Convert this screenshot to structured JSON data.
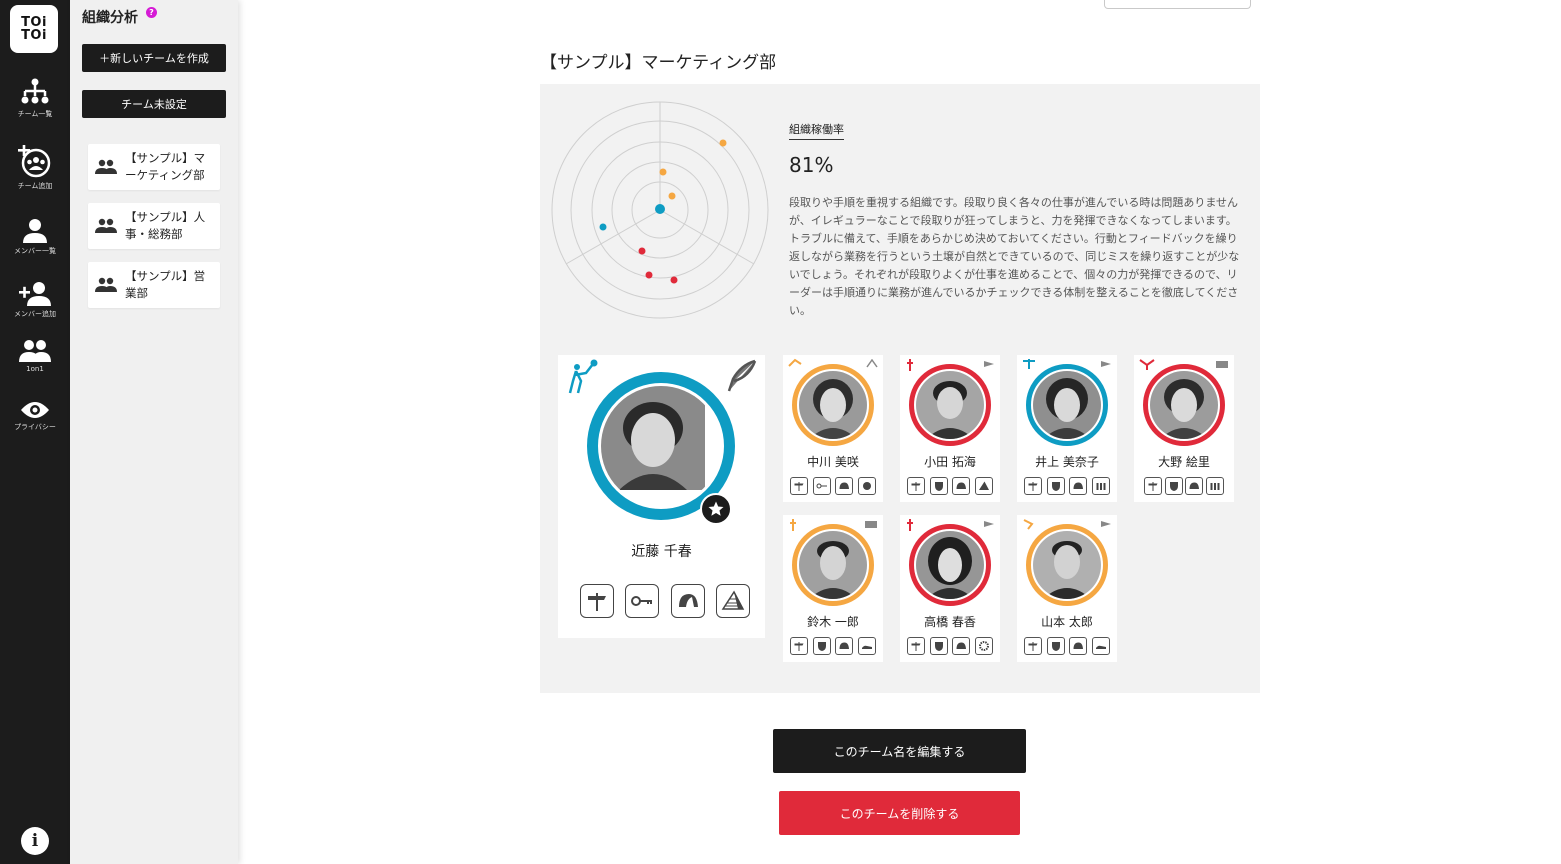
{
  "app": {
    "logo_text_1": "TOi",
    "logo_text_2": "TOi"
  },
  "rail": {
    "items": [
      {
        "label": "チーム一覧",
        "icon": "org-chart-icon"
      },
      {
        "label": "チーム追加",
        "icon": "add-team-icon"
      },
      {
        "label": "メンバー一覧",
        "icon": "person-icon"
      },
      {
        "label": "メンバー追加",
        "icon": "add-person-icon"
      },
      {
        "label": "1on1",
        "icon": "people-icon"
      },
      {
        "label": "プライバシー",
        "icon": "eye-icon"
      }
    ],
    "info_glyph": "i"
  },
  "sidebar": {
    "title": "組織分析",
    "help_glyph": "?",
    "new_team_label": "＋新しいチームを作成",
    "unassigned_label": "チーム未設定",
    "teams": [
      {
        "label": "【サンプル】マーケティング部"
      },
      {
        "label": "【サンプル】人事・総務部"
      },
      {
        "label": "【サンプル】営業部"
      }
    ]
  },
  "team": {
    "title": "【サンプル】マーケティング部",
    "rate_label": "組織稼働率",
    "rate_value": "81%",
    "description": "段取りや手順を重視する組織です。段取り良く各々の仕事が進んでいる時は問題ありませんが、イレギュラーなことで段取りが狂ってしまうと、力を発揮できなくなってしまいます。トラブルに備えて、手順をあらかじめ決めておいてください。行動とフィードバックを繰り返しながら業務を行うという土壌が自然とできているので、同じミスを繰り返すことが少ないでしょう。それぞれが段取りよくが仕事を進めることで、個々の力が発揮できるので、リーダーは手順通りに業務が進んでいるかチェックできる体制を整えることを徹底してください。",
    "radar_points": [
      {
        "color": "#f5a742"
      },
      {
        "color": "#f5a742"
      },
      {
        "color": "#f5a742"
      },
      {
        "color": "#0e9cc3"
      },
      {
        "color": "#0e9cc3"
      },
      {
        "color": "#e02a3a"
      },
      {
        "color": "#e02a3a"
      },
      {
        "color": "#e02a3a"
      }
    ]
  },
  "leader": {
    "name": "近藤 千春",
    "ring_color": "#0e9cc3"
  },
  "members": [
    {
      "name": "中川 美咲",
      "ring_color": "#f5a742"
    },
    {
      "name": "小田 拓海",
      "ring_color": "#e02a3a"
    },
    {
      "name": "井上 美奈子",
      "ring_color": "#0e9cc3"
    },
    {
      "name": "大野 絵里",
      "ring_color": "#e02a3a"
    },
    {
      "name": "鈴木 一郎",
      "ring_color": "#f5a742"
    },
    {
      "name": "高橋 春香",
      "ring_color": "#e02a3a"
    },
    {
      "name": "山本 太郎",
      "ring_color": "#f5a742"
    }
  ],
  "actions": {
    "edit_label": "このチーム名を編集する",
    "delete_label": "このチームを削除する"
  },
  "colors": {
    "accent_orange": "#f5a742",
    "accent_blue": "#0e9cc3",
    "accent_red": "#e02a3a",
    "dark": "#1c1c1c"
  }
}
